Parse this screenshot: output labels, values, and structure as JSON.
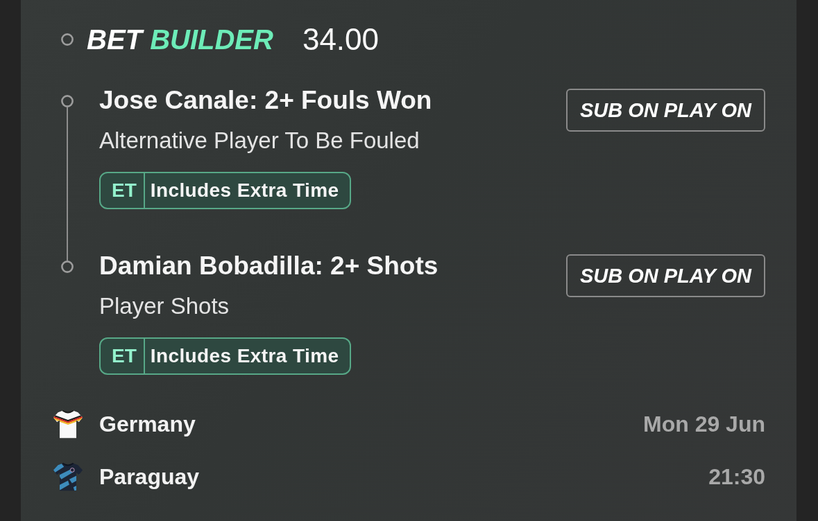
{
  "bet_builder": {
    "title_prefix": "BET",
    "title_highlight": "BUILDER",
    "odds": "34.00"
  },
  "selections": [
    {
      "title": "Jose Canale: 2+ Fouls Won",
      "market": "Alternative Player To Be Fouled",
      "badge": {
        "code": "ET",
        "label": "Includes Extra Time"
      },
      "button": "SUB ON PLAY ON"
    },
    {
      "title": "Damian Bobadilla: 2+ Shots",
      "market": "Player Shots",
      "badge": {
        "code": "ET",
        "label": "Includes Extra Time"
      },
      "button": "SUB ON PLAY ON"
    }
  ],
  "event": {
    "teams": [
      {
        "name": "Germany"
      },
      {
        "name": "Paraguay"
      }
    ],
    "date": "Mon 29 Jun",
    "time": "21:30"
  }
}
